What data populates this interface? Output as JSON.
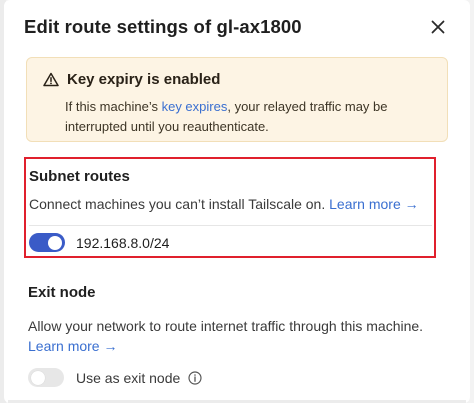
{
  "dialog": {
    "title": "Edit route settings of gl-ax1800",
    "close_icon": "close-icon"
  },
  "alert": {
    "icon": "warning-triangle-icon",
    "title": "Key expiry is enabled",
    "body_prefix": "If this machine’s ",
    "link_text": "key expires",
    "body_suffix": ", your relayed traffic may be interrupted until you reauthenticate.",
    "background": "#fdf4e4"
  },
  "subnet_routes": {
    "title": "Subnet routes",
    "description": "Connect machines you can’t install Tailscale on.",
    "learn_more": "Learn more →",
    "highlight_color": "#e0202d",
    "routes": [
      {
        "label": "192.168.8.0/24",
        "enabled": true
      }
    ]
  },
  "exit_node": {
    "title": "Exit node",
    "description": "Allow your network to route internet traffic through this machine.",
    "learn_more": "Learn more →",
    "toggle_label": "Use as exit node",
    "enabled": false,
    "info_icon": "info-icon"
  },
  "colors": {
    "accent": "#3a5bc7",
    "link": "#3a6fd0"
  }
}
